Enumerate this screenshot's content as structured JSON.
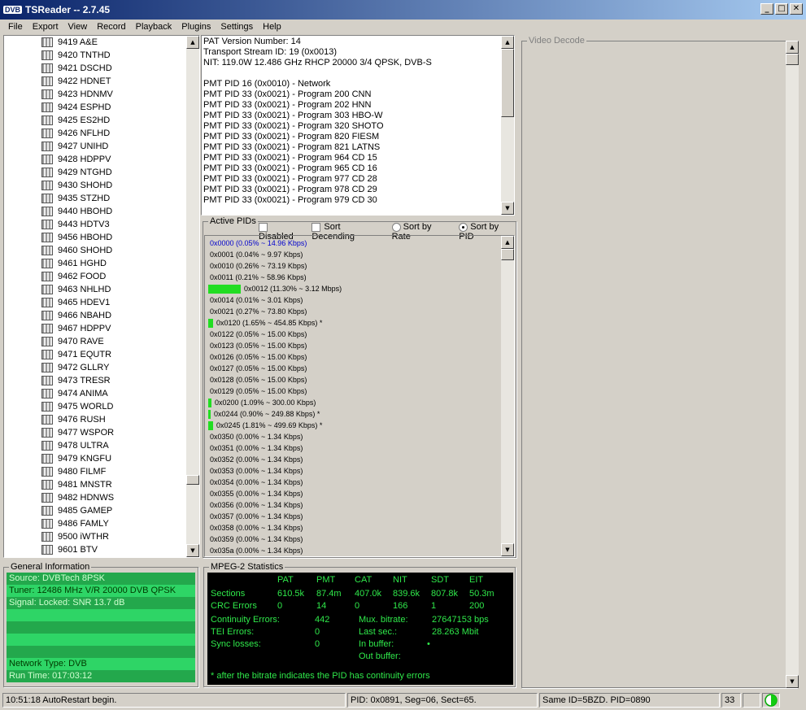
{
  "window": {
    "title": "TSReader -- 2.7.45",
    "logo": "DVB",
    "minimize": "_",
    "maximize": "□",
    "close": "✕"
  },
  "menu": [
    "File",
    "Export",
    "View",
    "Record",
    "Playback",
    "Plugins",
    "Settings",
    "Help"
  ],
  "tree": [
    "9419 A&E",
    "9420 TNTHD",
    "9421 DSCHD",
    "9422 HDNET",
    "9423 HDNMV",
    "9424 ESPHD",
    "9425 ES2HD",
    "9426 NFLHD",
    "9427 UNIHD",
    "9428 HDPPV",
    "9429 NTGHD",
    "9430 SHOHD",
    "9435 STZHD",
    "9440 HBOHD",
    "9443 HDTV3",
    "9456 HBOHD",
    "9460 SHOHD",
    "9461 HGHD",
    "9462 FOOD",
    "9463 NHLHD",
    "9465 HDEV1",
    "9466 NBAHD",
    "9467 HDPPV",
    "9470 RAVE",
    "9471 EQUTR",
    "9472 GLLRY",
    "9473 TRESR",
    "9474 ANIMA",
    "9475 WORLD",
    "9476 RUSH",
    "9477 WSPOR",
    "9478 ULTRA",
    "9479 KNGFU",
    "9480 FILMF",
    "9481 MNSTR",
    "9482 HDNWS",
    "9485 GAMEP",
    "9486 FAMLY",
    "9500 iWTHR",
    "9601 BTV"
  ],
  "pat_info": [
    "PAT Version Number: 14",
    "Transport Stream ID: 19 (0x0013)",
    "NIT: 119.0W 12.486 GHz RHCP 20000 3/4 QPSK, DVB-S",
    "",
    "PMT PID 16 (0x0010) - Network",
    "PMT PID 33 (0x0021) - Program 200 CNN",
    "PMT PID 33 (0x0021) - Program 202 HNN",
    "PMT PID 33 (0x0021) - Program 303 HBO-W",
    "PMT PID 33 (0x0021) - Program 320 SHOTO",
    "PMT PID 33 (0x0021) - Program 820 FIESM",
    "PMT PID 33 (0x0021) - Program 821 LATNS",
    "PMT PID 33 (0x0021) - Program 964 CD 15",
    "PMT PID 33 (0x0021) - Program 965 CD 16",
    "PMT PID 33 (0x0021) - Program 977 CD 28",
    "PMT PID 33 (0x0021) - Program 978 CD 29",
    "PMT PID 33 (0x0021) - Program 979 CD 30"
  ],
  "active_pids": {
    "title": "Active PIDs",
    "disabled_label": "Disabled",
    "sort_desc_label": "Sort Decending",
    "sort_rate_label": "Sort by Rate",
    "sort_pid_label": "Sort by PID",
    "rows": [
      {
        "text": "0x0000 (0.05% ~ 14.96 Kbps)",
        "bar": 0,
        "color": "#0000cc"
      },
      {
        "text": "0x0001 (0.04% ~ 9.97 Kbps)",
        "bar": 0,
        "color": "#000000"
      },
      {
        "text": "0x0010 (0.26% ~ 73.19 Kbps)",
        "bar": 0,
        "color": "#000000"
      },
      {
        "text": "0x0011 (0.21% ~ 58.96 Kbps)",
        "bar": 0,
        "color": "#000000"
      },
      {
        "text": "0x0012 (11.30% ~ 3.12 Mbps)",
        "bar": 11.3,
        "color": "#000000"
      },
      {
        "text": "0x0014 (0.01% ~ 3.01 Kbps)",
        "bar": 0,
        "color": "#000000"
      },
      {
        "text": "0x0021 (0.27% ~ 73.80 Kbps)",
        "bar": 0,
        "color": "#000000"
      },
      {
        "text": "0x0120 (1.65% ~ 454.85 Kbps) *",
        "bar": 1.65,
        "color": "#000000"
      },
      {
        "text": "0x0122 (0.05% ~ 15.00 Kbps)",
        "bar": 0,
        "color": "#000000"
      },
      {
        "text": "0x0123 (0.05% ~ 15.00 Kbps)",
        "bar": 0,
        "color": "#000000"
      },
      {
        "text": "0x0126 (0.05% ~ 15.00 Kbps)",
        "bar": 0,
        "color": "#000000"
      },
      {
        "text": "0x0127 (0.05% ~ 15.00 Kbps)",
        "bar": 0,
        "color": "#000000"
      },
      {
        "text": "0x0128 (0.05% ~ 15.00 Kbps)",
        "bar": 0,
        "color": "#000000"
      },
      {
        "text": "0x0129 (0.05% ~ 15.00 Kbps)",
        "bar": 0,
        "color": "#000000"
      },
      {
        "text": "0x0200 (1.09% ~ 300.00 Kbps)",
        "bar": 1.09,
        "color": "#000000"
      },
      {
        "text": "0x0244 (0.90% ~ 249.88 Kbps) *",
        "bar": 0.9,
        "color": "#000000"
      },
      {
        "text": "0x0245 (1.81% ~ 499.69 Kbps) *",
        "bar": 1.81,
        "color": "#000000"
      },
      {
        "text": "0x0350 (0.00% ~ 1.34 Kbps)",
        "bar": 0,
        "color": "#000000"
      },
      {
        "text": "0x0351 (0.00% ~ 1.34 Kbps)",
        "bar": 0,
        "color": "#000000"
      },
      {
        "text": "0x0352 (0.00% ~ 1.34 Kbps)",
        "bar": 0,
        "color": "#000000"
      },
      {
        "text": "0x0353 (0.00% ~ 1.34 Kbps)",
        "bar": 0,
        "color": "#000000"
      },
      {
        "text": "0x0354 (0.00% ~ 1.34 Kbps)",
        "bar": 0,
        "color": "#000000"
      },
      {
        "text": "0x0355 (0.00% ~ 1.34 Kbps)",
        "bar": 0,
        "color": "#000000"
      },
      {
        "text": "0x0356 (0.00% ~ 1.34 Kbps)",
        "bar": 0,
        "color": "#000000"
      },
      {
        "text": "0x0357 (0.00% ~ 1.34 Kbps)",
        "bar": 0,
        "color": "#000000"
      },
      {
        "text": "0x0358 (0.00% ~ 1.34 Kbps)",
        "bar": 0,
        "color": "#000000"
      },
      {
        "text": "0x0359 (0.00% ~ 1.34 Kbps)",
        "bar": 0,
        "color": "#000000"
      },
      {
        "text": "0x035a (0.00% ~ 1.34 Kbps)",
        "bar": 0,
        "color": "#000000"
      }
    ]
  },
  "video_decode": {
    "title": "Video Decode"
  },
  "general_info": {
    "title": "General Information",
    "rows": [
      "Source: DVBTech 8PSK",
      "Tuner: 12486 MHz V/R 20000 DVB QPSK",
      "Signal: Locked: SNR 13.7 dB",
      "",
      "",
      "",
      "",
      "Network Type: DVB",
      "Run Time: 017:03:12"
    ]
  },
  "mpeg2": {
    "title": "MPEG-2 Statistics",
    "headers": [
      "PAT",
      "PMT",
      "CAT",
      "NIT",
      "SDT",
      "EIT"
    ],
    "sections_label": "Sections",
    "sections": [
      "610.5k",
      "87.4m",
      "407.0k",
      "839.6k",
      "807.8k",
      "50.3m"
    ],
    "crc_label": "CRC Errors",
    "crc": [
      "0",
      "14",
      "0",
      "166",
      "1",
      "200"
    ],
    "continuity_label": "Continuity Errors:",
    "continuity": "442",
    "tei_label": "TEI Errors:",
    "tei": "0",
    "sync_label": "Sync losses:",
    "sync": "0",
    "mux_label": "Mux. bitrate:",
    "mux": "27647153 bps",
    "last_label": "Last sec.:",
    "last": "28.263 Mbit",
    "inbuf_label": "In buffer:",
    "inbuf": "•",
    "outbuf_label": "Out buffer:",
    "note": "* after the bitrate indicates the PID has continuity errors"
  },
  "statusbar": {
    "msg": "10:51:18 AutoRestart begin.",
    "pid": "PID: 0x0891, Seg=06, Sect=65.",
    "same": "Same ID=5BZD. PID=0890",
    "num": "33"
  },
  "colors": {
    "green_dark": "#23a84c",
    "green_light": "#2ed566",
    "stat_green": "#2fe84a",
    "bar": "#22dd22"
  }
}
